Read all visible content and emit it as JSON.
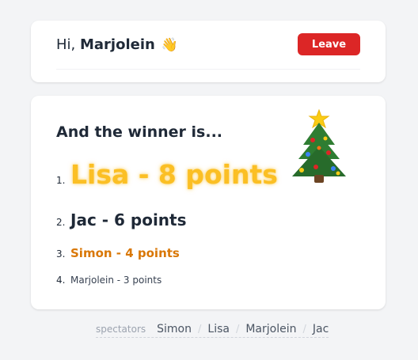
{
  "header": {
    "greeting": "Hi,",
    "user_name": "Marjolein",
    "wave_emoji": "👋",
    "leave_label": "Leave"
  },
  "results": {
    "title": "And the winner is...",
    "ranking": [
      {
        "rank": "1.",
        "label": "Lisa - 8 points"
      },
      {
        "rank": "2.",
        "label": "Jac - 6 points"
      },
      {
        "rank": "3.",
        "label": "Simon - 4 points"
      },
      {
        "rank": "4.",
        "label": "Marjolein - 3 points"
      }
    ],
    "decoration": "christmas-tree-icon"
  },
  "spectators": {
    "label": "spectators",
    "names": [
      "Simon",
      "Lisa",
      "Marjolein",
      "Jac"
    ],
    "separator": "/"
  },
  "colors": {
    "first": "#fbbf24",
    "third": "#d97706",
    "leave_button": "#dc2626",
    "background": "#f3f4f6"
  }
}
